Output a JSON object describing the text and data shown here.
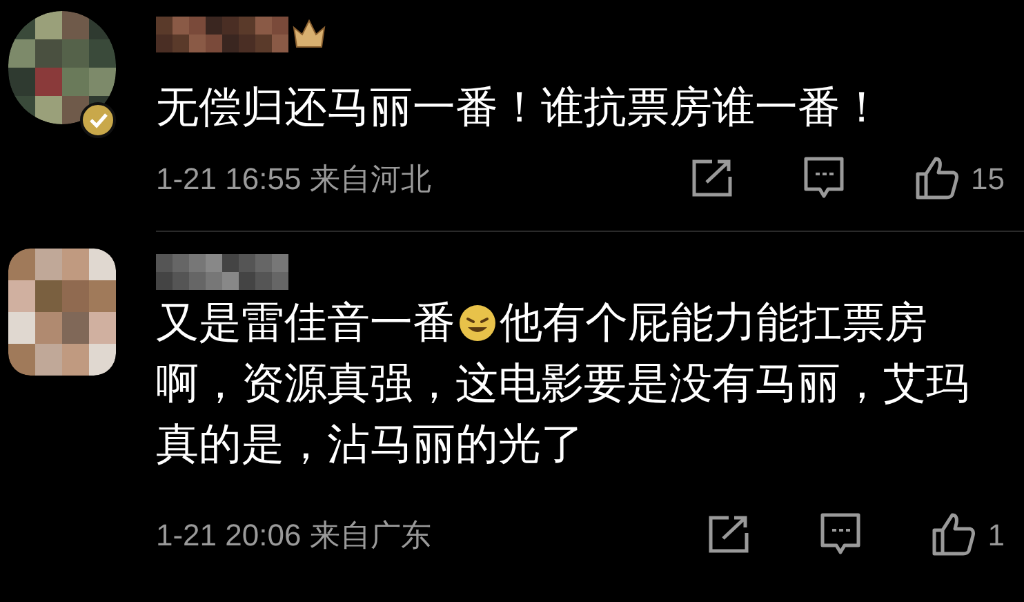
{
  "comments": [
    {
      "crown_badge": true,
      "verified": true,
      "lines": [
        [
          {
            "kind": "text",
            "text": "无偿归还马丽一番！谁抗票房谁一番！"
          }
        ]
      ],
      "meta": "1-21 16:55 来自河北",
      "likes": "15"
    },
    {
      "crown_badge": false,
      "verified": false,
      "lines": [
        [
          {
            "kind": "text",
            "text": "又是雷佳音一番"
          },
          {
            "kind": "emoji"
          },
          {
            "kind": "text",
            "text": "他有个屁能力能扛票房"
          }
        ],
        [
          {
            "kind": "text",
            "text": "啊，资源真强，这电影要是没有马丽，艾玛"
          }
        ],
        [
          {
            "kind": "text",
            "text": "真的是，沾马丽的光了"
          }
        ]
      ],
      "meta": "1-21 20:06 来自广东",
      "likes": "1"
    }
  ]
}
